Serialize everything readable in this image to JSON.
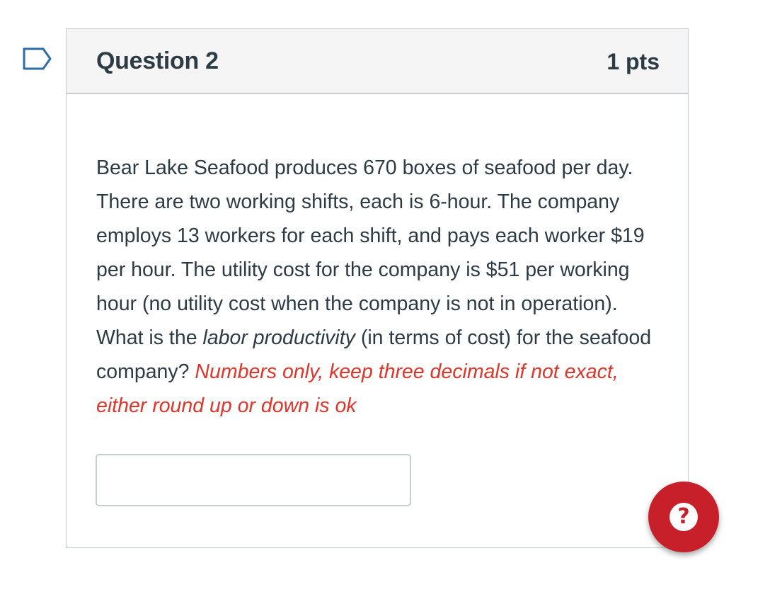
{
  "question": {
    "title": "Question 2",
    "points": "1 pts",
    "text_part1": "Bear Lake Seafood produces 670 boxes of seafood per day. There are two working shifts, each is 6-hour. The company employs 13 workers for each shift, and pays each worker $19 per hour. The utility cost for the company is $51 per working hour (no utility cost when the company is not in operation). What is the ",
    "text_emphasis": "labor productivity",
    "text_part2": " (in terms of cost) for the seafood company? ",
    "instruction": "Numbers only, keep three decimals if not exact, either round up or down is ok",
    "answer_value": "",
    "answer_placeholder": ""
  },
  "icons": {
    "flag": "bookmark-flag-icon",
    "help": "question-mark-icon"
  },
  "colors": {
    "instruction": "#e0352b",
    "help_button": "#c8202a",
    "header_bg": "#f5f5f5",
    "border": "#c7cdd1",
    "text": "#2d3b45"
  },
  "help_button": {
    "glyph": "?"
  }
}
